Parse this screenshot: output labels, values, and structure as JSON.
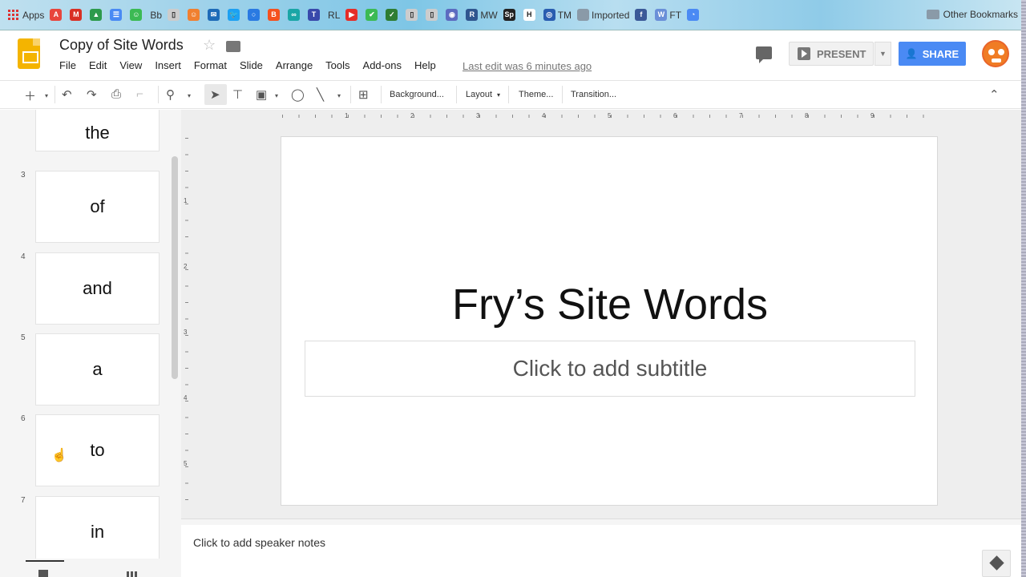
{
  "bookmarks": {
    "apps_label": "Apps",
    "items": [
      {
        "label": "",
        "color": "#e8453c",
        "glyph": "A"
      },
      {
        "label": "",
        "color": "#d93025",
        "glyph": "M"
      },
      {
        "label": "",
        "color": "#2d9a4c",
        "glyph": "▲"
      },
      {
        "label": "",
        "color": "#4a8af4",
        "glyph": "☰"
      },
      {
        "label": "",
        "color": "#3cba54",
        "glyph": "☺"
      },
      {
        "label": "Bb",
        "color": "",
        "glyph": ""
      },
      {
        "label": "",
        "color": "#ccc",
        "glyph": "▯"
      },
      {
        "label": "",
        "color": "#f08030",
        "glyph": "☺"
      },
      {
        "label": "",
        "color": "#1e6bb8",
        "glyph": "✉"
      },
      {
        "label": "",
        "color": "#1da1f2",
        "glyph": "🐦"
      },
      {
        "label": "",
        "color": "#2a7ae2",
        "glyph": "○"
      },
      {
        "label": "",
        "color": "#f5511e",
        "glyph": "B"
      },
      {
        "label": "",
        "color": "#1aa6a6",
        "glyph": "∞"
      },
      {
        "label": "",
        "color": "#3949ab",
        "glyph": "T"
      },
      {
        "label": "RL",
        "color": "",
        "glyph": ""
      },
      {
        "label": "",
        "color": "#e52d27",
        "glyph": "▶"
      },
      {
        "label": "",
        "color": "#3cba54",
        "glyph": "✔"
      },
      {
        "label": "",
        "color": "#2e7d32",
        "glyph": "✓"
      },
      {
        "label": "",
        "color": "#ccc",
        "glyph": "▯"
      },
      {
        "label": "",
        "color": "#ccc",
        "glyph": "▯"
      },
      {
        "label": "",
        "color": "#5c6bc0",
        "glyph": "◉"
      },
      {
        "label": "MW",
        "color": "#30568f",
        "glyph": "R"
      },
      {
        "label": "",
        "color": "#222",
        "glyph": "Sp"
      },
      {
        "label": "",
        "color": "#fff",
        "glyph": "H"
      },
      {
        "label": "TM",
        "color": "#2a5db0",
        "glyph": "◎"
      },
      {
        "label": "Imported",
        "color": "#8a9aa8",
        "glyph": ""
      },
      {
        "label": "",
        "color": "#3b5998",
        "glyph": "f"
      },
      {
        "label": "FT",
        "color": "#6a8fd8",
        "glyph": "W"
      },
      {
        "label": "",
        "color": "#4a8af4",
        "glyph": "◔"
      }
    ],
    "other_label": "Other Bookmarks"
  },
  "header": {
    "doc_title": "Copy of Site Words",
    "menu": [
      "File",
      "Edit",
      "View",
      "Insert",
      "Format",
      "Slide",
      "Arrange",
      "Tools",
      "Add-ons",
      "Help"
    ],
    "last_edit": "Last edit was 6 minutes ago",
    "present_label": "PRESENT",
    "share_label": "SHARE"
  },
  "toolbar": {
    "background_label": "Background...",
    "layout_label": "Layout",
    "theme_label": "Theme...",
    "transition_label": "Transition..."
  },
  "filmstrip": {
    "slides": [
      {
        "num": "",
        "text": "the"
      },
      {
        "num": "3",
        "text": "of"
      },
      {
        "num": "4",
        "text": "and"
      },
      {
        "num": "5",
        "text": "a"
      },
      {
        "num": "6",
        "text": "to"
      },
      {
        "num": "7",
        "text": "in"
      }
    ]
  },
  "ruler": {
    "top_numbers": [
      "1",
      "2",
      "3",
      "4",
      "5",
      "6",
      "7",
      "8",
      "9"
    ],
    "left_numbers": [
      "1",
      "2",
      "3",
      "4",
      "5"
    ]
  },
  "slide": {
    "title": "Fry’s Site Words",
    "subtitle_placeholder": "Click to add subtitle"
  },
  "notes": {
    "placeholder": "Click to add speaker notes"
  }
}
